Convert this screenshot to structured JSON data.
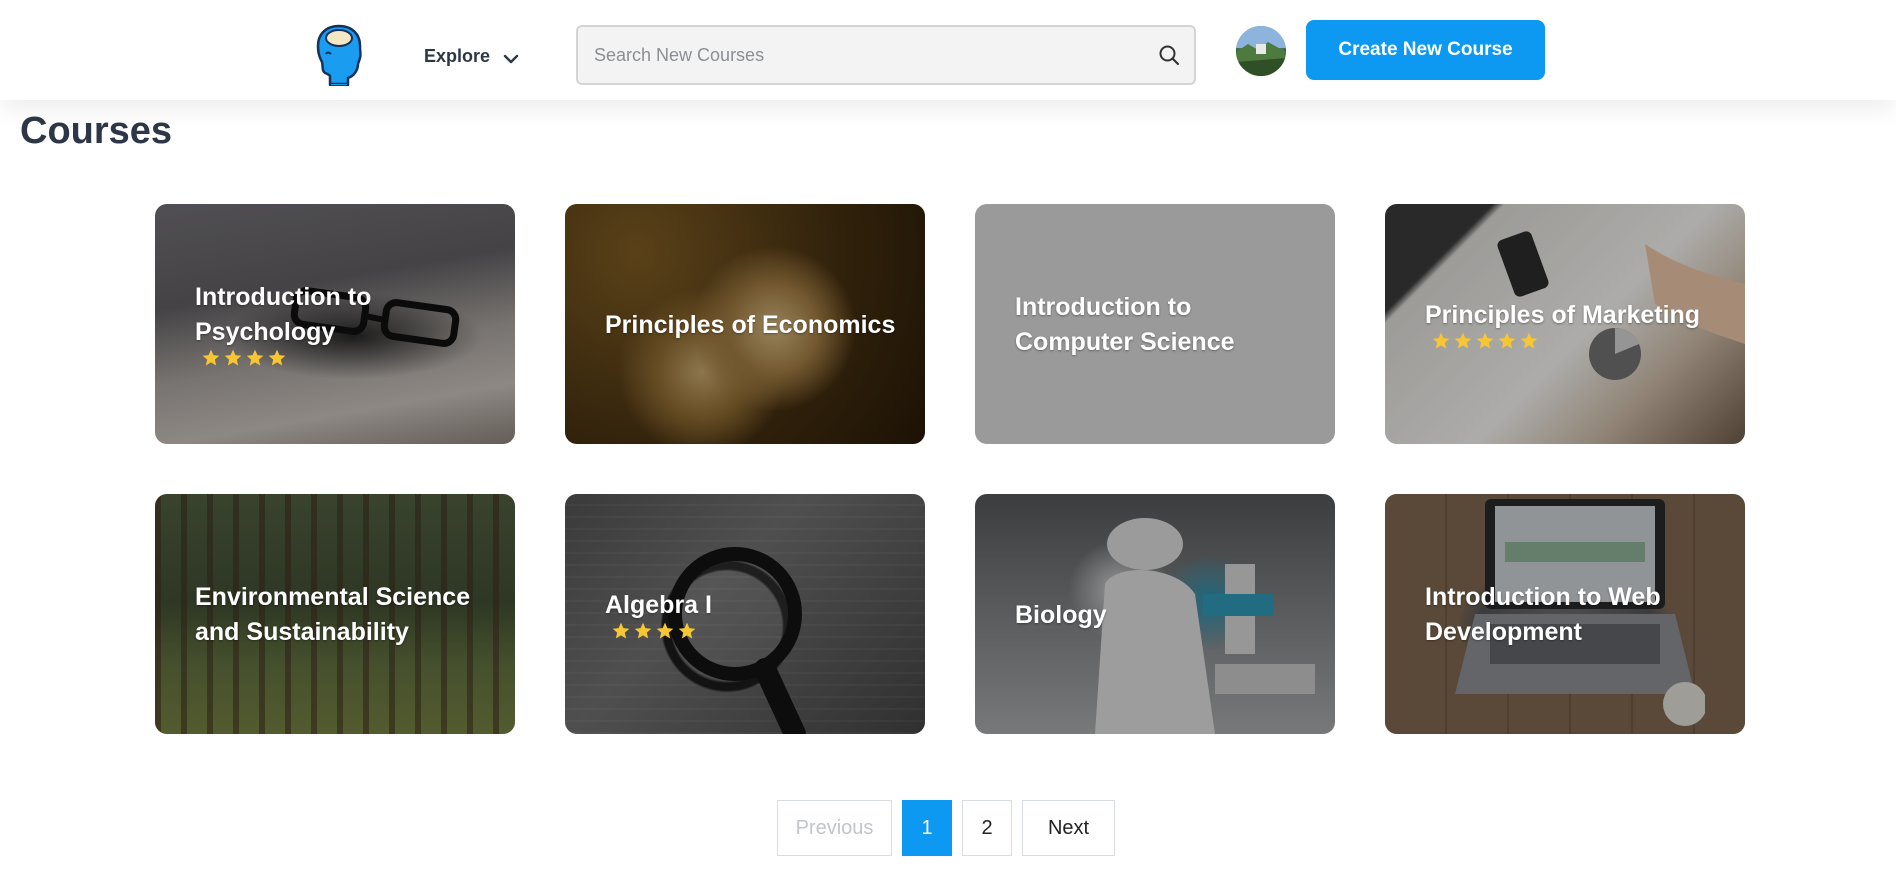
{
  "header": {
    "logo_icon": "head-profile-logo-icon",
    "explore_label": "Explore",
    "search_placeholder": "Search New Courses",
    "search_value": "",
    "create_button_label": "Create New Course"
  },
  "page": {
    "title": "Courses"
  },
  "courses": [
    {
      "title": "Introduction to Psychology",
      "rating": 4
    },
    {
      "title": "Principles of Economics",
      "rating": 0
    },
    {
      "title": "Introduction to Computer Science",
      "rating": 0
    },
    {
      "title": "Principles of Marketing",
      "rating": 5
    },
    {
      "title": "Environmental Science and Sustainability",
      "rating": 0
    },
    {
      "title": "Algebra I",
      "rating": 4
    },
    {
      "title": "Biology",
      "rating": 0
    },
    {
      "title": "Introduction to Web Development",
      "rating": 0
    }
  ],
  "pagination": {
    "previous_label": "Previous",
    "pages": [
      "1",
      "2"
    ],
    "current_page": "1",
    "next_label": "Next"
  },
  "colors": {
    "accent": "#0d99f2",
    "star": "#f6c634",
    "title_text": "#2d3748"
  }
}
